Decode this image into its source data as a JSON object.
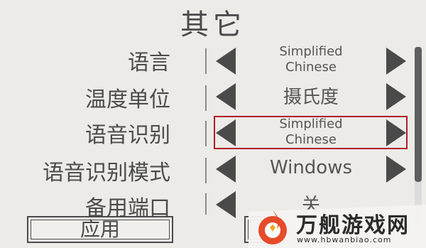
{
  "page": {
    "title": "其它"
  },
  "settings": [
    {
      "label": "语言",
      "value": "Simplified Chinese",
      "value_line1": "Simplified",
      "value_line2": "Chinese"
    },
    {
      "label": "温度单位",
      "value": "摄氏度"
    },
    {
      "label": "语音识别",
      "value": "Simplified Chinese",
      "value_line1": "Simplified",
      "value_line2": "Chinese"
    },
    {
      "label": "语音识别模式",
      "value": "Windows"
    },
    {
      "label": "备用端口",
      "value": "关"
    }
  ],
  "buttons": {
    "apply": "应用"
  },
  "watermark": {
    "name": "万舰游戏网",
    "url": "www.hbwanbiao.com"
  },
  "colors": {
    "highlight": "#b01e25",
    "background": "#ecebe8",
    "arrow": "#4a4a4a"
  }
}
